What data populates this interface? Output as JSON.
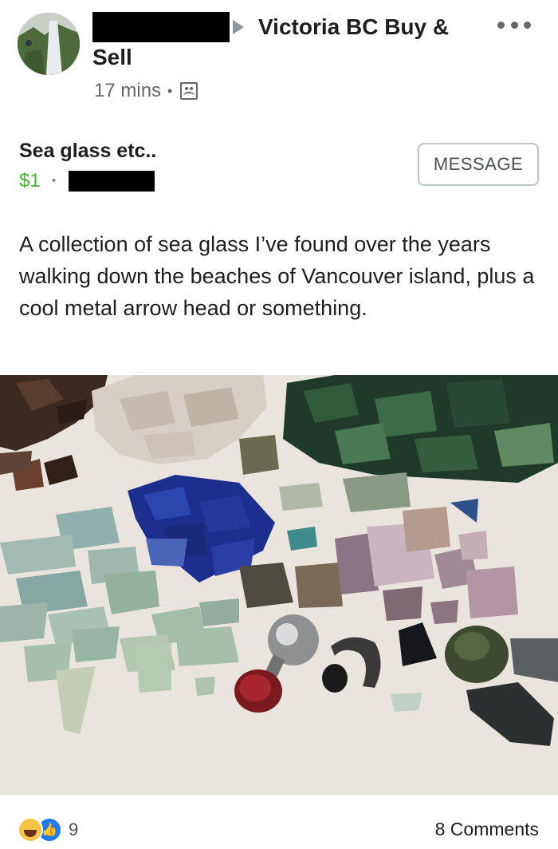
{
  "post": {
    "group_name": "Victoria BC Buy & Sell",
    "time": "17 mins",
    "separator": "•"
  },
  "listing": {
    "title": "Sea glass etc..",
    "price": "$1",
    "price_separator": "•",
    "message_button": "MESSAGE",
    "description": "A collection of sea glass I’ve found over the years walking down the beaches of Vancouver island, plus a cool metal arrow head or something."
  },
  "footer": {
    "reaction_count": "9",
    "comments": "8 Comments",
    "like_glyph": "👍"
  },
  "icons": {
    "avatar": "waterfall-photo",
    "audience": "group-icon",
    "more": "more-icon",
    "arrow": "arrow-right-icon"
  },
  "colors": {
    "price": "#42b72a",
    "muted": "#65676b",
    "like": "#1d7bf2",
    "haha": "#f7c445"
  }
}
